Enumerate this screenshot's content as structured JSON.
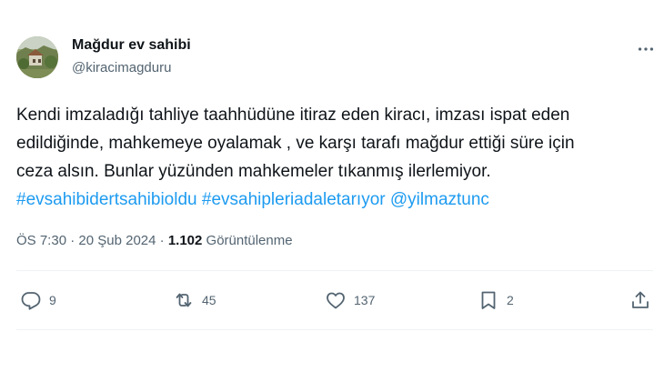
{
  "author": {
    "name": "Mağdur ev sahibi",
    "handle": "@kiracimagduru"
  },
  "tweet": {
    "lines": [
      "Kendi imzaladığı tahliye taahhüdüne itiraz eden kiracı, imzası ispat eden",
      "edildiğinde, mahkemeye oyalamak , ve karşı tarafı mağdur ettiği süre için",
      "ceza alsın. Bunlar yüzünden mahkemeler tıkanmış ilerlemiyor."
    ],
    "hashtags": [
      "#evsahibidertsahibioldu",
      "#evsahipleriadaletarıyor"
    ],
    "mention": "@yilmaztunc"
  },
  "meta": {
    "time": "ÖS 7:30",
    "separator1": " · ",
    "date": "20 Şub 2024",
    "separator2": " · ",
    "views_count": "1.102",
    "views_label": " Görüntülenme"
  },
  "actions": {
    "replies": "9",
    "reposts": "45",
    "likes": "137",
    "bookmarks": "2"
  },
  "icons": {
    "more": "more-horizontal-icon",
    "reply": "reply-icon",
    "repost": "repost-icon",
    "like": "heart-icon",
    "bookmark": "bookmark-icon",
    "share": "share-icon"
  },
  "colors": {
    "link": "#1d9bf0",
    "text": "#0f1419",
    "secondary": "#536471"
  }
}
